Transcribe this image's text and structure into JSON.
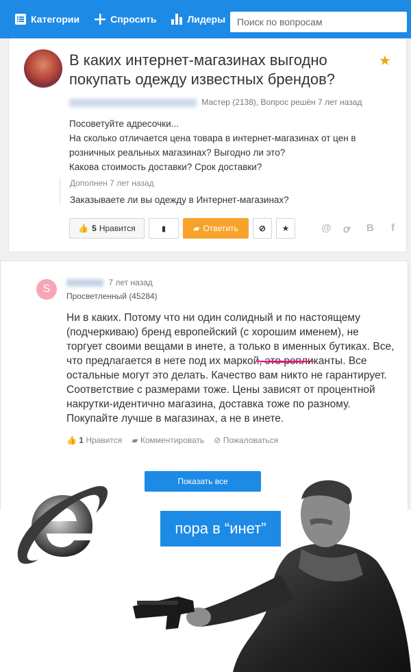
{
  "nav": {
    "categories": "Категории",
    "ask": "Спросить",
    "leaders": "Лидеры",
    "search_placeholder": "Поиск по вопросам"
  },
  "question": {
    "title": "В каких интернет-магазинах выгодно покупать одежду известных брендов?",
    "meta": "Мастер (2138), Вопрос решён 7 лет назад",
    "body": [
      "Посоветуйте адресочки...",
      "На сколько отличается цена товара в интернет-магазинах от цен в розничных реальных магазинах? Выгодно ли это?",
      "Какова стоимость доставки? Срок доставки?"
    ],
    "addition_label": "Дополнен 7 лет назад",
    "addition_text": "Заказываете ли вы одежду в Интернет-магазинах?",
    "like_count": "5",
    "like_label": "Нравится",
    "answer_label": "Ответить"
  },
  "answer": {
    "avatar_letter": "S",
    "time": "7 лет назад",
    "rank": "Просветленный (45284)",
    "text_before": "Ни в каких. Потому что ни один солидный и по настоящему (подчеркиваю) бренд европейский (с хорошим именем), не торгует своими вещами в инете, а только в именных бутиках. Все, что предлагается в нете под их маркой, это ",
    "highlight": "репликанты",
    "text_after": ". Все остальные могут это делать. Качество вам никто не гарантирует. Соответствие с размерами тоже. Цены зависят от процентной накрутки-идентично магазина, доставка тоже по разному. Покупайте лучше в магазинах, а не в инете.",
    "like_count": "1",
    "like_label": "Нравится",
    "comment_label": "Комментировать",
    "complain_label": "Пожаловаться",
    "show_all": "Показать все"
  },
  "meme": {
    "caption": "пора в “инет”"
  },
  "colors": {
    "brand": "#1d8ae6",
    "answer_button": "#f7a32b",
    "highlight_underline": "#e4157a"
  }
}
